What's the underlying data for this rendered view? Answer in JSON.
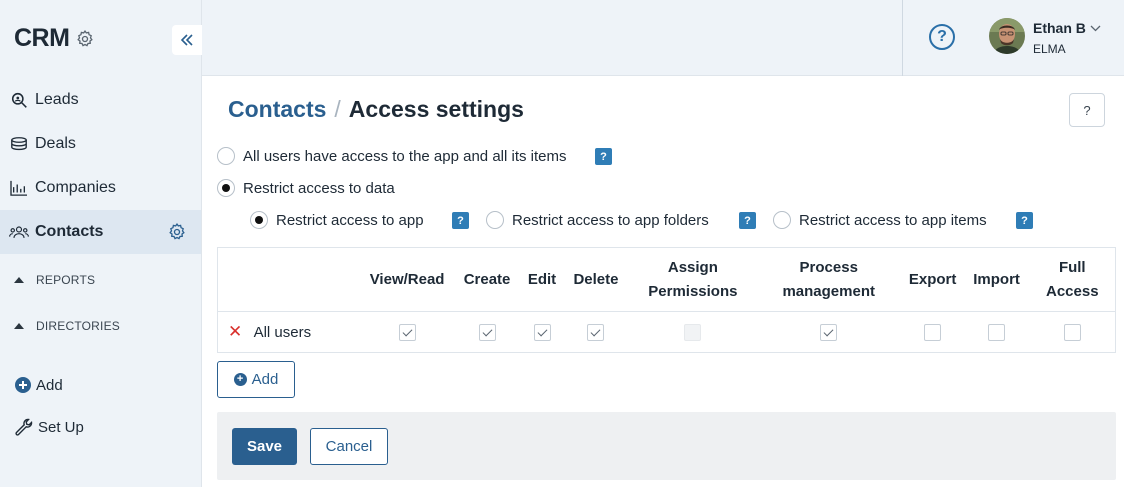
{
  "sidebar": {
    "brand": "CRM",
    "nav": [
      {
        "label": "Leads",
        "icon": "search-icon"
      },
      {
        "label": "Deals",
        "icon": "stack-icon"
      },
      {
        "label": "Companies",
        "icon": "chart-icon"
      },
      {
        "label": "Contacts",
        "icon": "people-icon",
        "active": true
      }
    ],
    "sections": [
      "REPORTS",
      "DIRECTORIES"
    ],
    "add_label": "Add",
    "setup_label": "Set Up"
  },
  "topbar": {
    "user_name": "Ethan B",
    "user_org": "ELMA"
  },
  "breadcrumb": {
    "parent": "Contacts",
    "separator": "/",
    "current": "Access settings"
  },
  "access": {
    "option_all": "All users have access to the app and all its items",
    "option_restrict": "Restrict access to data",
    "sub_app": "Restrict access to app",
    "sub_folders": "Restrict access to app folders",
    "sub_items": "Restrict access to app items",
    "help_badge": "?"
  },
  "table": {
    "headers": [
      "View/Read",
      "Create",
      "Edit",
      "Delete",
      "Assign Permissions",
      "Process management",
      "Export",
      "Import",
      "Full Access"
    ],
    "headers_line1": [
      "View/Read",
      "Create",
      "Edit",
      "Delete",
      "Assign",
      "Process",
      "Export",
      "Import",
      "Full"
    ],
    "headers_line2": [
      "",
      "",
      "",
      "",
      "Permissions",
      "management",
      "",
      "",
      "Access"
    ],
    "rows": [
      {
        "name": "All users",
        "checks": [
          "checked",
          "checked",
          "checked",
          "checked",
          "disabled",
          "checked",
          "empty",
          "empty",
          "empty"
        ]
      }
    ]
  },
  "buttons": {
    "add": "Add",
    "save": "Save",
    "cancel": "Cancel"
  },
  "colors": {
    "primary": "#2a5f8f",
    "help_badge": "#2f7db6",
    "remove": "#d9302c",
    "sidebar_bg": "#eef3f8"
  }
}
